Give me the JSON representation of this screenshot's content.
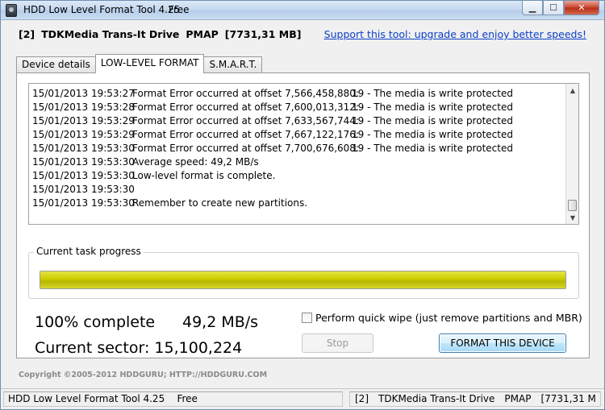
{
  "window": {
    "title": "HDD Low Level Format Tool 4.25",
    "edition": "Free"
  },
  "header": {
    "device_index": "[2]",
    "device_name": "TDKMedia Trans-It Drive",
    "device_mode": "PMAP",
    "device_size": "[7731,31 MB]",
    "support_link": "Support this tool: upgrade and enjoy better speeds!"
  },
  "tabs": [
    {
      "label": "Device details",
      "active": false
    },
    {
      "label": "LOW-LEVEL FORMAT",
      "active": true
    },
    {
      "label": "S.M.A.R.T.",
      "active": false
    }
  ],
  "log": [
    {
      "time": "15/01/2013 19:53:27",
      "message": "Format Error occurred at offset 7,566,458,880:",
      "detail": "19 - The media is write protected"
    },
    {
      "time": "15/01/2013 19:53:28",
      "message": "Format Error occurred at offset 7,600,013,312:",
      "detail": "19 - The media is write protected"
    },
    {
      "time": "15/01/2013 19:53:29",
      "message": "Format Error occurred at offset 7,633,567,744:",
      "detail": "19 - The media is write protected"
    },
    {
      "time": "15/01/2013 19:53:29",
      "message": "Format Error occurred at offset 7,667,122,176:",
      "detail": "19 - The media is write protected"
    },
    {
      "time": "15/01/2013 19:53:30",
      "message": "Format Error occurred at offset 7,700,676,608:",
      "detail": "19 - The media is write protected"
    },
    {
      "time": "15/01/2013 19:53:30",
      "message": "Average speed: 49,2 MB/s",
      "detail": ""
    },
    {
      "time": "15/01/2013 19:53:30",
      "message": "Low-level format is complete.",
      "detail": ""
    },
    {
      "time": "15/01/2013 19:53:30",
      "message": "",
      "detail": ""
    },
    {
      "time": "15/01/2013 19:53:30",
      "message": "Remember to create new partitions.",
      "detail": ""
    }
  ],
  "progress": {
    "label": "Current task progress",
    "fraction": 1.0,
    "color": "#d0d000"
  },
  "stats": {
    "complete": "100% complete",
    "speed": "49,2 MB/s",
    "sector": "Current sector: 15,100,224"
  },
  "options": {
    "quick_wipe_label": "Perform quick wipe (just remove partitions and MBR)",
    "quick_wipe_checked": false
  },
  "buttons": {
    "stop": "Stop",
    "format": "FORMAT THIS DEVICE"
  },
  "footer": {
    "copyright": "Copyright ©2005-2012 HDDGURU;  HTTP://HDDGURU.COM"
  },
  "statusbar": {
    "app": "HDD Low Level Format Tool 4.25",
    "edition": "Free",
    "device_index": "[2]",
    "device_name": "TDKMedia Trans-It Drive",
    "device_mode": "PMAP",
    "device_size": "[7731,31 M"
  },
  "colors": {
    "link": "#0b3fc8",
    "progress_fill": "#d0d000"
  },
  "icons": {
    "app": "hdd-icon",
    "minimize": "minimize-icon",
    "maximize": "maximize-icon",
    "close": "close-icon"
  }
}
